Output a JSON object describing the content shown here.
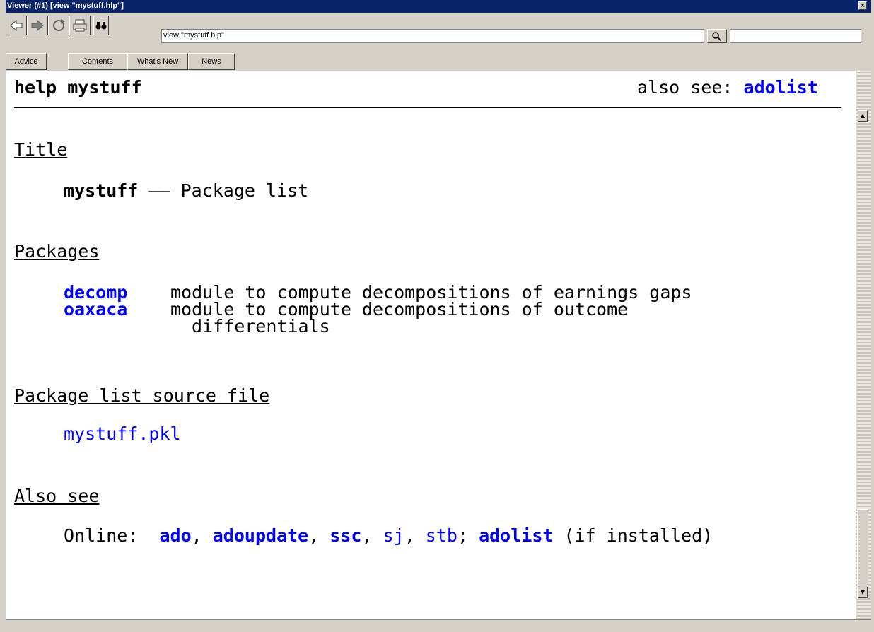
{
  "window": {
    "title": "Viewer (#1) [view \"mystuff.hlp\"]"
  },
  "toolbar": {
    "address_value": "view \"mystuff.hlp\"",
    "find_value": ""
  },
  "tabs": [
    "Advice",
    "Contents",
    "What's New",
    "News"
  ],
  "help": {
    "header_left": "help mystuff",
    "also_see_prefix": "also see: ",
    "also_see_link": "adolist",
    "sections": {
      "title": "Title",
      "packages": "Packages",
      "source": "Package list source file",
      "also": "Also see"
    },
    "title_cmd": "mystuff",
    "title_dash": " —— ",
    "title_desc": "Package list",
    "packages": [
      {
        "name": "decomp",
        "desc": "module to compute decompositions of earnings gaps"
      },
      {
        "name": "oaxaca",
        "desc": "module to compute decompositions of outcome",
        "desc2": "differentials"
      }
    ],
    "source_file": "mystuff.pkl",
    "online_label": "Online:  ",
    "online_links": [
      "ado",
      "adoupdate",
      "ssc",
      "sj",
      "stb",
      "adolist"
    ],
    "sep_comma": ", ",
    "sep_semi": "; ",
    "if_installed": " (if installed)"
  }
}
